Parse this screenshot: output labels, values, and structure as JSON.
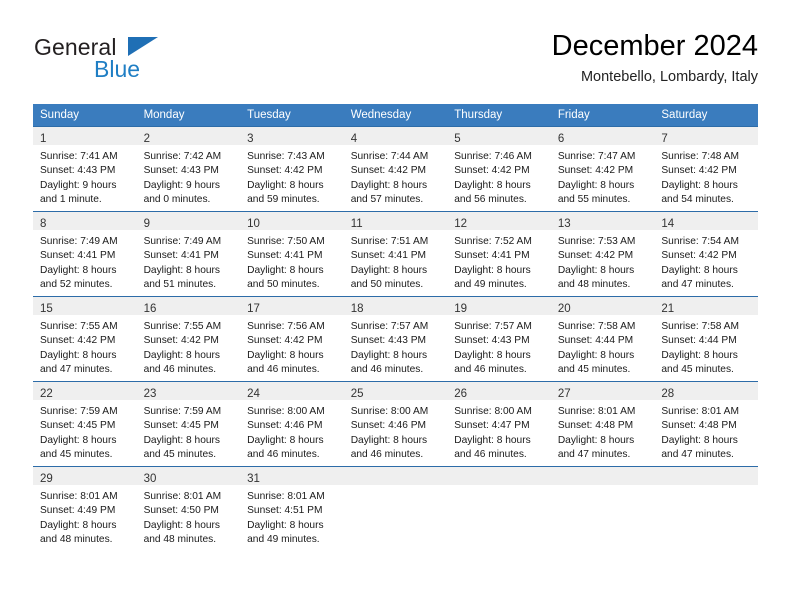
{
  "brand": {
    "name_part1": "General",
    "name_part2": "Blue",
    "triangle_color": "#1f6fb5",
    "blue_color": "#1f7ec4"
  },
  "header": {
    "title": "December 2024",
    "subtitle": "Montebello, Lombardy, Italy"
  },
  "theme": {
    "header_bg": "#3a7cbe",
    "header_text": "#ffffff",
    "daynum_band_bg": "#efefef",
    "border_color": "#2d6ca8"
  },
  "weekdays": [
    "Sunday",
    "Monday",
    "Tuesday",
    "Wednesday",
    "Thursday",
    "Friday",
    "Saturday"
  ],
  "weeks": [
    [
      {
        "day": "1",
        "sunrise": "Sunrise: 7:41 AM",
        "sunset": "Sunset: 4:43 PM",
        "daylight1": "Daylight: 9 hours",
        "daylight2": "and 1 minute."
      },
      {
        "day": "2",
        "sunrise": "Sunrise: 7:42 AM",
        "sunset": "Sunset: 4:43 PM",
        "daylight1": "Daylight: 9 hours",
        "daylight2": "and 0 minutes."
      },
      {
        "day": "3",
        "sunrise": "Sunrise: 7:43 AM",
        "sunset": "Sunset: 4:42 PM",
        "daylight1": "Daylight: 8 hours",
        "daylight2": "and 59 minutes."
      },
      {
        "day": "4",
        "sunrise": "Sunrise: 7:44 AM",
        "sunset": "Sunset: 4:42 PM",
        "daylight1": "Daylight: 8 hours",
        "daylight2": "and 57 minutes."
      },
      {
        "day": "5",
        "sunrise": "Sunrise: 7:46 AM",
        "sunset": "Sunset: 4:42 PM",
        "daylight1": "Daylight: 8 hours",
        "daylight2": "and 56 minutes."
      },
      {
        "day": "6",
        "sunrise": "Sunrise: 7:47 AM",
        "sunset": "Sunset: 4:42 PM",
        "daylight1": "Daylight: 8 hours",
        "daylight2": "and 55 minutes."
      },
      {
        "day": "7",
        "sunrise": "Sunrise: 7:48 AM",
        "sunset": "Sunset: 4:42 PM",
        "daylight1": "Daylight: 8 hours",
        "daylight2": "and 54 minutes."
      }
    ],
    [
      {
        "day": "8",
        "sunrise": "Sunrise: 7:49 AM",
        "sunset": "Sunset: 4:41 PM",
        "daylight1": "Daylight: 8 hours",
        "daylight2": "and 52 minutes."
      },
      {
        "day": "9",
        "sunrise": "Sunrise: 7:49 AM",
        "sunset": "Sunset: 4:41 PM",
        "daylight1": "Daylight: 8 hours",
        "daylight2": "and 51 minutes."
      },
      {
        "day": "10",
        "sunrise": "Sunrise: 7:50 AM",
        "sunset": "Sunset: 4:41 PM",
        "daylight1": "Daylight: 8 hours",
        "daylight2": "and 50 minutes."
      },
      {
        "day": "11",
        "sunrise": "Sunrise: 7:51 AM",
        "sunset": "Sunset: 4:41 PM",
        "daylight1": "Daylight: 8 hours",
        "daylight2": "and 50 minutes."
      },
      {
        "day": "12",
        "sunrise": "Sunrise: 7:52 AM",
        "sunset": "Sunset: 4:41 PM",
        "daylight1": "Daylight: 8 hours",
        "daylight2": "and 49 minutes."
      },
      {
        "day": "13",
        "sunrise": "Sunrise: 7:53 AM",
        "sunset": "Sunset: 4:42 PM",
        "daylight1": "Daylight: 8 hours",
        "daylight2": "and 48 minutes."
      },
      {
        "day": "14",
        "sunrise": "Sunrise: 7:54 AM",
        "sunset": "Sunset: 4:42 PM",
        "daylight1": "Daylight: 8 hours",
        "daylight2": "and 47 minutes."
      }
    ],
    [
      {
        "day": "15",
        "sunrise": "Sunrise: 7:55 AM",
        "sunset": "Sunset: 4:42 PM",
        "daylight1": "Daylight: 8 hours",
        "daylight2": "and 47 minutes."
      },
      {
        "day": "16",
        "sunrise": "Sunrise: 7:55 AM",
        "sunset": "Sunset: 4:42 PM",
        "daylight1": "Daylight: 8 hours",
        "daylight2": "and 46 minutes."
      },
      {
        "day": "17",
        "sunrise": "Sunrise: 7:56 AM",
        "sunset": "Sunset: 4:42 PM",
        "daylight1": "Daylight: 8 hours",
        "daylight2": "and 46 minutes."
      },
      {
        "day": "18",
        "sunrise": "Sunrise: 7:57 AM",
        "sunset": "Sunset: 4:43 PM",
        "daylight1": "Daylight: 8 hours",
        "daylight2": "and 46 minutes."
      },
      {
        "day": "19",
        "sunrise": "Sunrise: 7:57 AM",
        "sunset": "Sunset: 4:43 PM",
        "daylight1": "Daylight: 8 hours",
        "daylight2": "and 46 minutes."
      },
      {
        "day": "20",
        "sunrise": "Sunrise: 7:58 AM",
        "sunset": "Sunset: 4:44 PM",
        "daylight1": "Daylight: 8 hours",
        "daylight2": "and 45 minutes."
      },
      {
        "day": "21",
        "sunrise": "Sunrise: 7:58 AM",
        "sunset": "Sunset: 4:44 PM",
        "daylight1": "Daylight: 8 hours",
        "daylight2": "and 45 minutes."
      }
    ],
    [
      {
        "day": "22",
        "sunrise": "Sunrise: 7:59 AM",
        "sunset": "Sunset: 4:45 PM",
        "daylight1": "Daylight: 8 hours",
        "daylight2": "and 45 minutes."
      },
      {
        "day": "23",
        "sunrise": "Sunrise: 7:59 AM",
        "sunset": "Sunset: 4:45 PM",
        "daylight1": "Daylight: 8 hours",
        "daylight2": "and 45 minutes."
      },
      {
        "day": "24",
        "sunrise": "Sunrise: 8:00 AM",
        "sunset": "Sunset: 4:46 PM",
        "daylight1": "Daylight: 8 hours",
        "daylight2": "and 46 minutes."
      },
      {
        "day": "25",
        "sunrise": "Sunrise: 8:00 AM",
        "sunset": "Sunset: 4:46 PM",
        "daylight1": "Daylight: 8 hours",
        "daylight2": "and 46 minutes."
      },
      {
        "day": "26",
        "sunrise": "Sunrise: 8:00 AM",
        "sunset": "Sunset: 4:47 PM",
        "daylight1": "Daylight: 8 hours",
        "daylight2": "and 46 minutes."
      },
      {
        "day": "27",
        "sunrise": "Sunrise: 8:01 AM",
        "sunset": "Sunset: 4:48 PM",
        "daylight1": "Daylight: 8 hours",
        "daylight2": "and 47 minutes."
      },
      {
        "day": "28",
        "sunrise": "Sunrise: 8:01 AM",
        "sunset": "Sunset: 4:48 PM",
        "daylight1": "Daylight: 8 hours",
        "daylight2": "and 47 minutes."
      }
    ],
    [
      {
        "day": "29",
        "sunrise": "Sunrise: 8:01 AM",
        "sunset": "Sunset: 4:49 PM",
        "daylight1": "Daylight: 8 hours",
        "daylight2": "and 48 minutes."
      },
      {
        "day": "30",
        "sunrise": "Sunrise: 8:01 AM",
        "sunset": "Sunset: 4:50 PM",
        "daylight1": "Daylight: 8 hours",
        "daylight2": "and 48 minutes."
      },
      {
        "day": "31",
        "sunrise": "Sunrise: 8:01 AM",
        "sunset": "Sunset: 4:51 PM",
        "daylight1": "Daylight: 8 hours",
        "daylight2": "and 49 minutes."
      },
      {
        "day": "",
        "sunrise": "",
        "sunset": "",
        "daylight1": "",
        "daylight2": ""
      },
      {
        "day": "",
        "sunrise": "",
        "sunset": "",
        "daylight1": "",
        "daylight2": ""
      },
      {
        "day": "",
        "sunrise": "",
        "sunset": "",
        "daylight1": "",
        "daylight2": ""
      },
      {
        "day": "",
        "sunrise": "",
        "sunset": "",
        "daylight1": "",
        "daylight2": ""
      }
    ]
  ]
}
